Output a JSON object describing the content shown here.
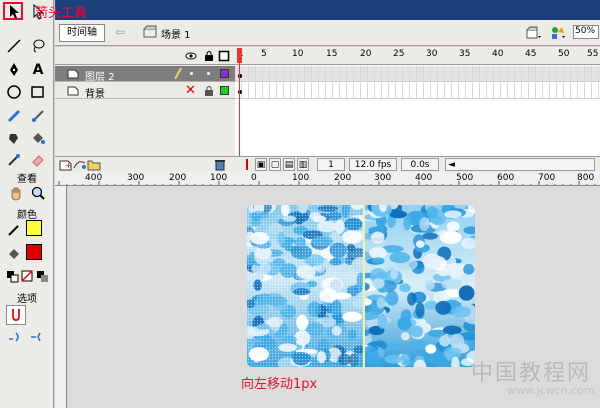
{
  "app": {
    "timeline_tab": "时间轴",
    "scene_name": "场景 1",
    "zoom": "50%"
  },
  "tools_panel": {
    "view_label": "查看",
    "colors_label": "颜色",
    "options_label": "选项"
  },
  "annotations": {
    "tool_note": "箭头工具",
    "caption": "向左移动1px"
  },
  "layers": [
    {
      "name": "图层 2",
      "selected": true,
      "color": "#8b2ecf"
    },
    {
      "name": "背景",
      "selected": false,
      "color": "#22cc22"
    }
  ],
  "frame_ruler": [
    "1",
    "5",
    "10",
    "15",
    "20",
    "25",
    "30",
    "35",
    "40",
    "45",
    "50",
    "55"
  ],
  "timeline_footer": {
    "frame": "1",
    "fps": "12.0 fps",
    "time": "0.0s"
  },
  "stage_ruler": [
    "400",
    "300",
    "200",
    "100",
    "0",
    "100",
    "200",
    "300",
    "400",
    "500",
    "600",
    "700",
    "800"
  ],
  "watermark": {
    "title": "中国教程网",
    "url": "www.jcwcn.com"
  },
  "colors": {
    "stroke": "#000000",
    "fill_swatch": "#ffff33",
    "fill_red": "#e00000",
    "accent": "#e0142c"
  }
}
